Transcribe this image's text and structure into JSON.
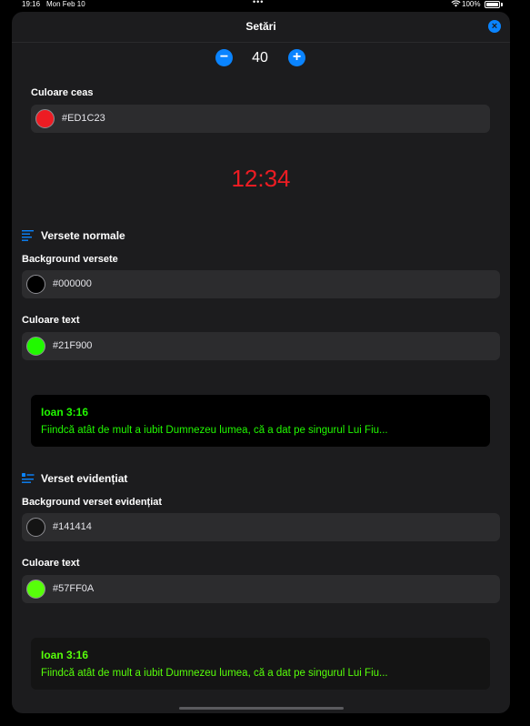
{
  "status_bar": {
    "time": "19:16",
    "date": "Mon Feb 10",
    "battery": "100%"
  },
  "header": {
    "title": "Setări"
  },
  "stepper": {
    "value": "40",
    "minus": "−",
    "plus": "+"
  },
  "clock_color": {
    "label": "Culoare ceas",
    "value": "#ED1C23",
    "preview_time": "12:34"
  },
  "normal_verses": {
    "section_title": "Versete normale",
    "background_label": "Background versete",
    "background_value": "#000000",
    "text_color_label": "Culoare text",
    "text_color_value": "#21F900",
    "preview_ref": "Ioan 3:16",
    "preview_text": "Fiindcă atât de mult a iubit Dumnezeu lumea, că a dat pe singurul Lui Fiu..."
  },
  "highlighted_verse": {
    "section_title": "Verset evidențiat",
    "background_label": "Background verset evidențiat",
    "background_value": "#141414",
    "text_color_label": "Culoare text",
    "text_color_value": "#57FF0A",
    "preview_ref": "Ioan 3:16",
    "preview_text": "Fiindcă atât de mult a iubit Dumnezeu lumea, că a dat pe singurul Lui Fiu..."
  },
  "colors": {
    "accent": "#0a84ff",
    "sheet_bg": "#1c1c1e",
    "field_bg": "#2c2c2e"
  }
}
